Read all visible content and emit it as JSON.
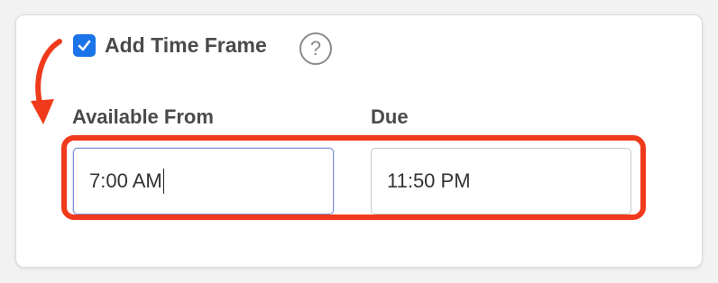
{
  "time_frame": {
    "checkbox_label": "Add Time Frame",
    "checked": true,
    "help_glyph": "?"
  },
  "fields": {
    "available_from": {
      "label": "Available From",
      "value": "7:00 AM"
    },
    "due": {
      "label": "Due",
      "value": "11:50 PM"
    }
  },
  "colors": {
    "accent": "#1a73e8",
    "annotation": "#f03a1c",
    "text": "#4a4a4a"
  },
  "icons": {
    "checkbox": "checkmark-icon",
    "help": "question-circle-icon",
    "annotation_arrow": "curved-arrow-icon"
  }
}
